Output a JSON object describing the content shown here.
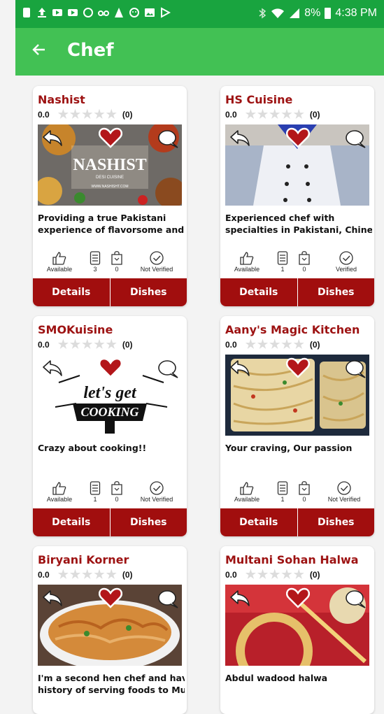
{
  "status": {
    "battery": "8%",
    "time": "4:38 PM"
  },
  "appbar": {
    "title": "Chef"
  },
  "labels": {
    "details": "Details",
    "dishes": "Dishes",
    "available": "Available"
  },
  "chefs": [
    {
      "name": "Nashist",
      "rating": "0.0",
      "rating_count": "(0)",
      "desc1": "Providing a true Pakistani",
      "desc2": "experience of flavorsome and ...",
      "menus": "3",
      "orders": "0",
      "verification": "Not Verified",
      "image_text": "NASHIST",
      "image_subtext": "DESI CUISINE",
      "image_url_text": "WWW.NASHISHT.COM"
    },
    {
      "name": "HS Cuisine",
      "rating": "0.0",
      "rating_count": "(0)",
      "desc1": "Experienced chef with",
      "desc2": "specialties in Pakistani, Chines...",
      "menus": "1",
      "orders": "0",
      "verification": "Verified"
    },
    {
      "name": "SMOKuisine",
      "rating": "0.0",
      "rating_count": "(0)",
      "desc1": "Crazy about cooking!!",
      "desc2": "",
      "menus": "1",
      "orders": "0",
      "verification": "Not Verified",
      "image_text": "let's get",
      "image_subtext": "COOKING"
    },
    {
      "name": "Aany's Magic Kitchen",
      "rating": "0.0",
      "rating_count": "(0)",
      "desc1": "Your craving, Our passion",
      "desc2": "",
      "menus": "1",
      "orders": "0",
      "verification": "Not Verified"
    },
    {
      "name": "Biryani Korner",
      "rating": "0.0",
      "rating_count": "(0)",
      "desc1": "I'm a second hen chef and have",
      "desc2": "history of serving foods to Mug..",
      "menus": "",
      "orders": "",
      "verification": ""
    },
    {
      "name": "Multani Sohan Halwa",
      "rating": "0.0",
      "rating_count": "(0)",
      "desc1": "Abdul wadood halwa",
      "desc2": "",
      "menus": "",
      "orders": "",
      "verification": ""
    }
  ]
}
